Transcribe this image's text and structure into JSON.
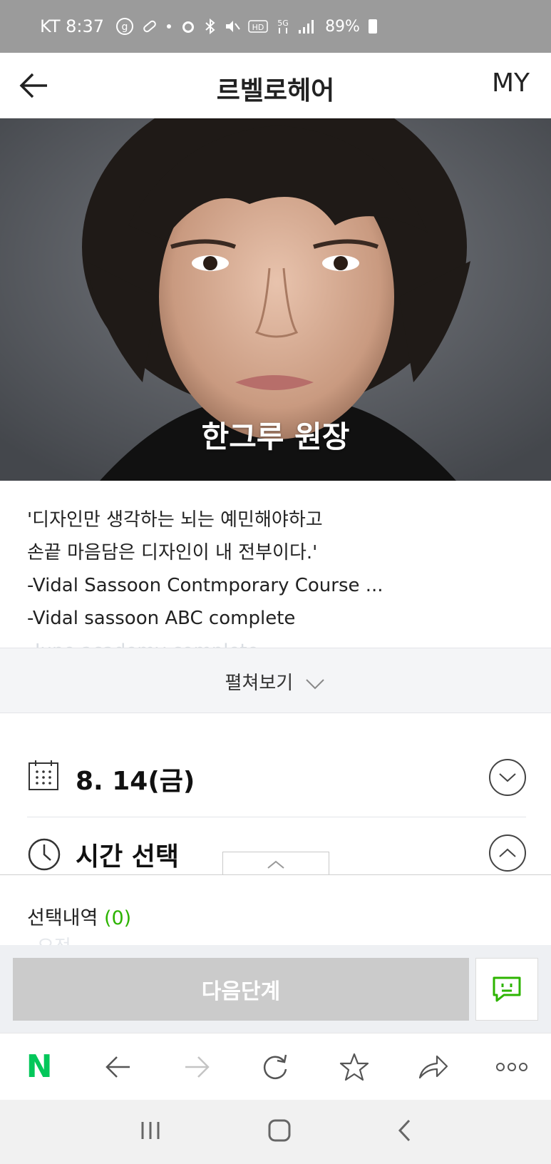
{
  "status_bar": {
    "carrier_time": "KT 8:37",
    "battery": "89%",
    "icons": [
      "g-circle-icon",
      "pill-icon",
      "dot-icon",
      "alarm-icon",
      "bluetooth-icon",
      "mute-icon",
      "hd-icon",
      "5g-icon",
      "signal-icon",
      "battery-icon"
    ]
  },
  "header": {
    "title": "르벨로헤어",
    "my_label": "MY",
    "back_icon": "arrow-left-icon"
  },
  "hero": {
    "name": "한그루 원장"
  },
  "description": {
    "lines": [
      "'디자인만 생각하는 뇌는 예민해야하고",
      "손끝 마음담은 디자인이 내 전부이다.'",
      "-Vidal Sassoon Contmporary Course ...",
      "-Vidal sassoon ABC complete"
    ],
    "faded_line": "-Juno academy complete",
    "expand_label": "펼쳐보기"
  },
  "date_section": {
    "date": "8. 14(금)"
  },
  "time_section": {
    "label": "시간 선택"
  },
  "sheet": {
    "selection_label": "선택내역",
    "selection_count": "(0)",
    "faint_text": "오전",
    "next_label": "다음단계"
  },
  "colors": {
    "accent_green": "#2db400",
    "naver_green": "#03c75a",
    "disabled_button": "#cbcbcb"
  },
  "browser_toolbar": {
    "logo": "N",
    "icons": [
      "naver-logo",
      "back-arrow-icon",
      "forward-arrow-icon",
      "refresh-icon",
      "star-icon",
      "share-icon",
      "more-icon"
    ]
  },
  "system_nav": {
    "icons": [
      "recents-icon",
      "home-icon",
      "back-icon"
    ]
  }
}
